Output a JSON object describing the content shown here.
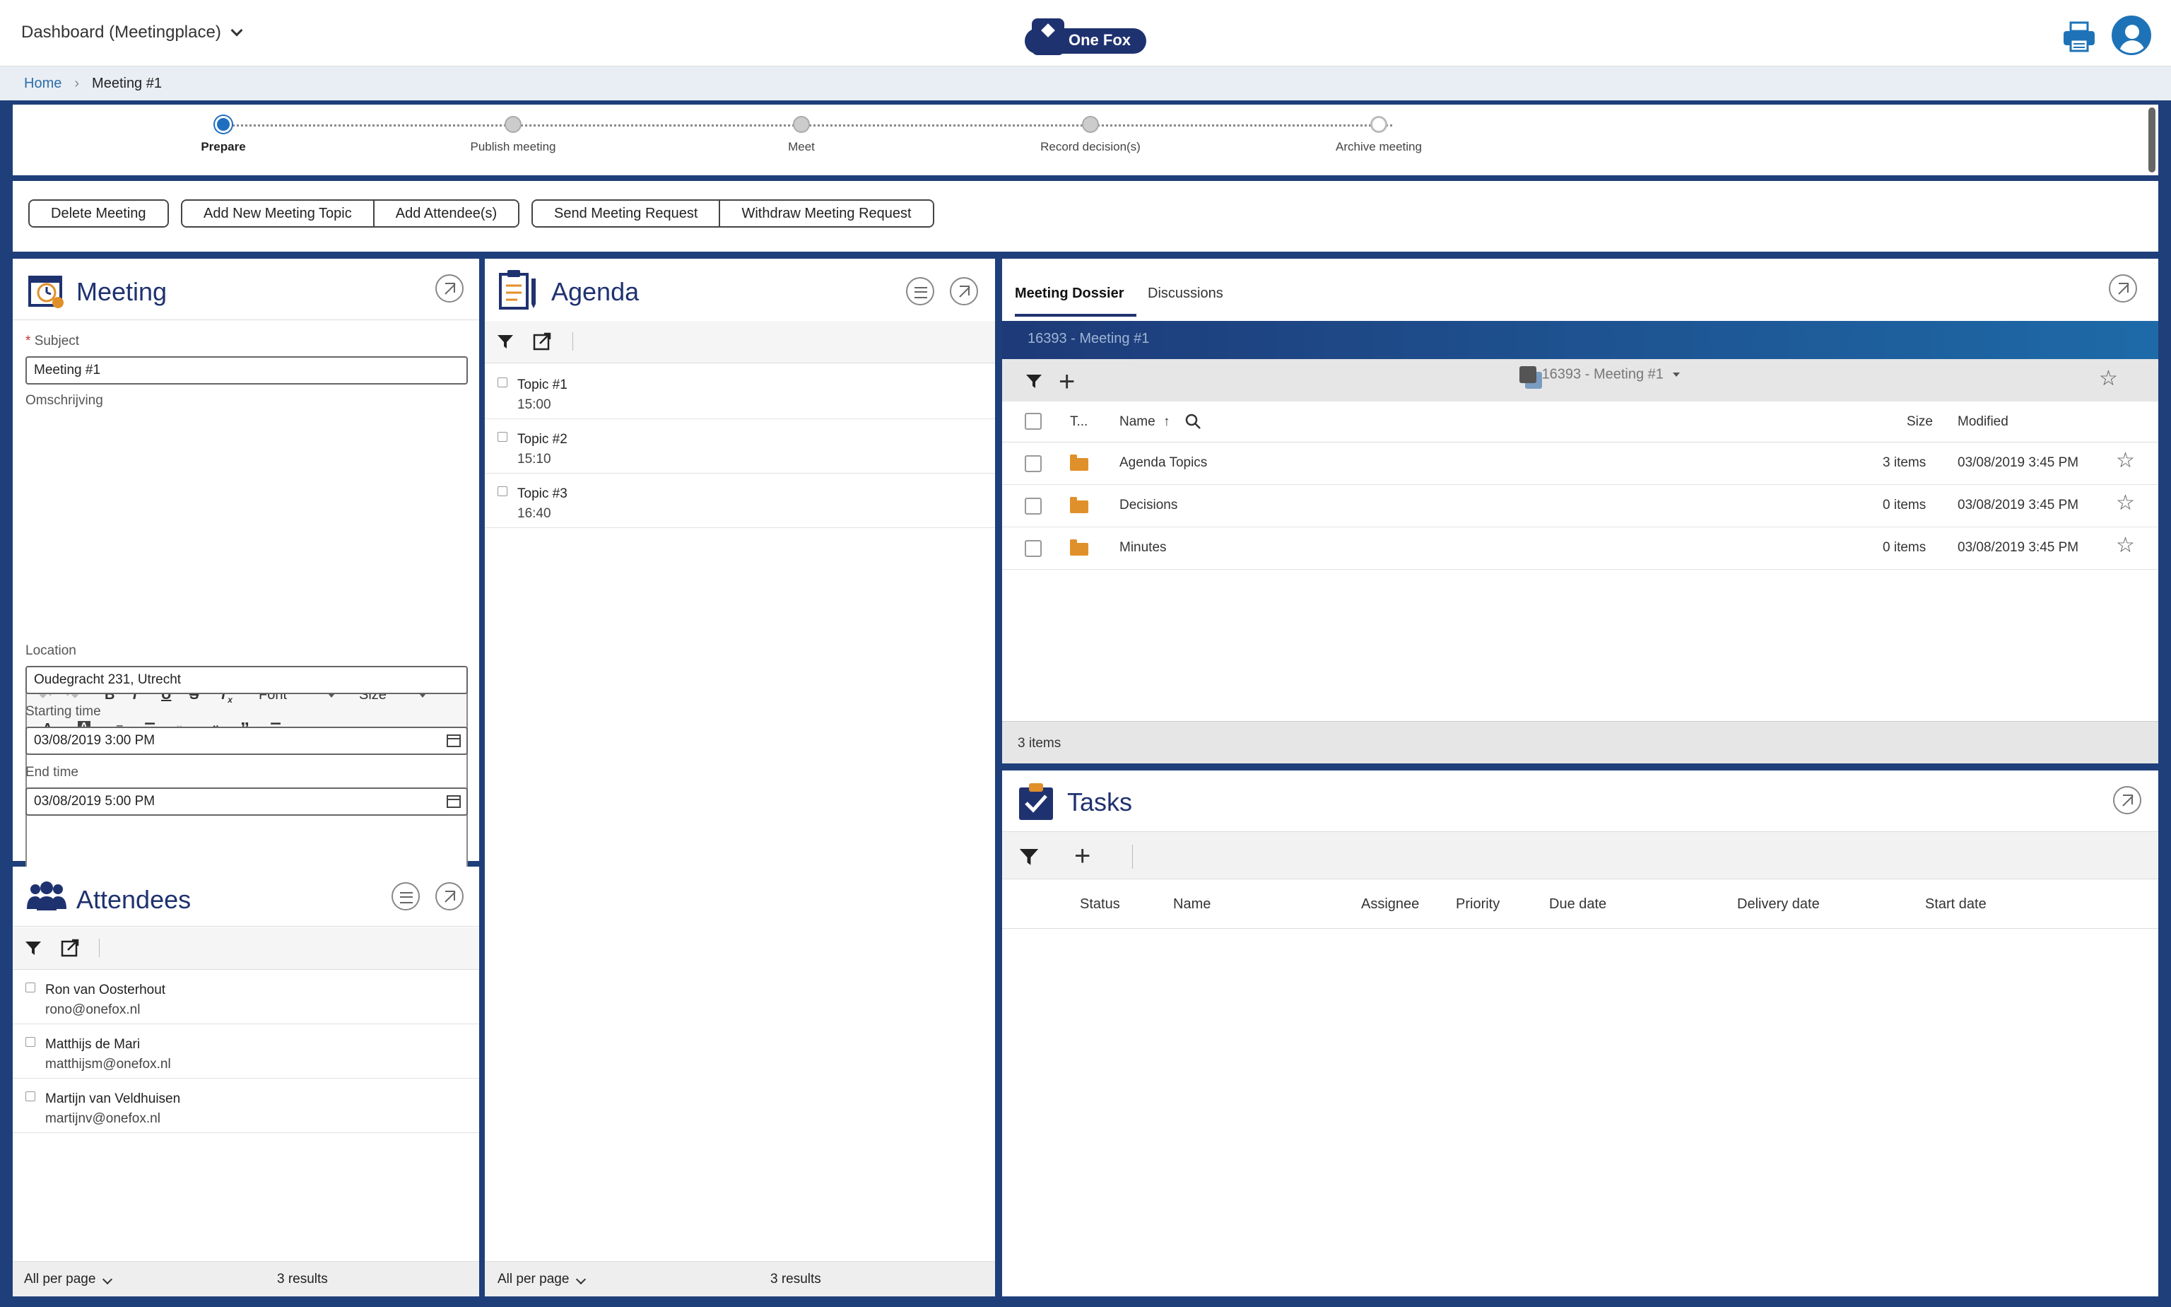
{
  "header": {
    "dashboard_title": "Dashboard (Meetingplace)",
    "logo_text": "One Fox"
  },
  "breadcrumb": {
    "home": "Home",
    "current": "Meeting #1"
  },
  "steps": [
    {
      "label": "Prepare",
      "state": "active"
    },
    {
      "label": "Publish meeting",
      "state": "pending"
    },
    {
      "label": "Meet",
      "state": "pending"
    },
    {
      "label": "Record decision(s)",
      "state": "pending"
    },
    {
      "label": "Archive meeting",
      "state": "pending"
    }
  ],
  "toolbar": {
    "delete_meeting": "Delete Meeting",
    "add_topic": "Add New Meeting Topic",
    "add_attendees": "Add Attendee(s)",
    "send_request": "Send Meeting Request",
    "withdraw_request": "Withdraw Meeting Request"
  },
  "meeting": {
    "title": "Meeting",
    "subject_label": "Subject",
    "subject_value": "Meeting #1",
    "description_label": "Omschrijving",
    "editor_font": "Font",
    "editor_size": "Size",
    "location_label": "Location",
    "location_value": "Oudegracht 231, Utrecht",
    "start_label": "Starting time",
    "start_value": "03/08/2019 3:00 PM",
    "end_label": "End time",
    "end_value": "03/08/2019 5:00 PM"
  },
  "attendees": {
    "title": "Attendees",
    "items": [
      {
        "name": "Ron van Oosterhout",
        "email": "rono@onefox.nl"
      },
      {
        "name": "Matthijs de Mari",
        "email": "matthijsm@onefox.nl"
      },
      {
        "name": "Martijn van Veldhuisen",
        "email": "martijnv@onefox.nl"
      }
    ],
    "per_page": "All per page",
    "results": "3 results"
  },
  "agenda": {
    "title": "Agenda",
    "items": [
      {
        "name": "Topic #1",
        "time": "15:00"
      },
      {
        "name": "Topic #2",
        "time": "15:10"
      },
      {
        "name": "Topic #3",
        "time": "16:40"
      }
    ],
    "per_page": "All per page",
    "results": "3 results"
  },
  "dossier": {
    "tab_active": "Meeting Dossier",
    "tab_other": "Discussions",
    "band_title": "16393 - Meeting #1",
    "folder_select": "16393 - Meeting #1",
    "columns": {
      "type": "T...",
      "name": "Name",
      "size": "Size",
      "modified": "Modified"
    },
    "rows": [
      {
        "name": "Agenda Topics",
        "size": "3 items",
        "modified": "03/08/2019 3:45 PM"
      },
      {
        "name": "Decisions",
        "size": "0 items",
        "modified": "03/08/2019 3:45 PM"
      },
      {
        "name": "Minutes",
        "size": "0 items",
        "modified": "03/08/2019 3:45 PM"
      }
    ],
    "footer": "3 items"
  },
  "tasks": {
    "title": "Tasks",
    "columns": {
      "status": "Status",
      "name": "Name",
      "assignee": "Assignee",
      "priority": "Priority",
      "due": "Due date",
      "delivery": "Delivery date",
      "start": "Start date"
    }
  },
  "colors": {
    "brand": "#1f3270",
    "accent": "#1f6fbf",
    "folder": "#e0902a",
    "frame": "#1f3f7a"
  }
}
